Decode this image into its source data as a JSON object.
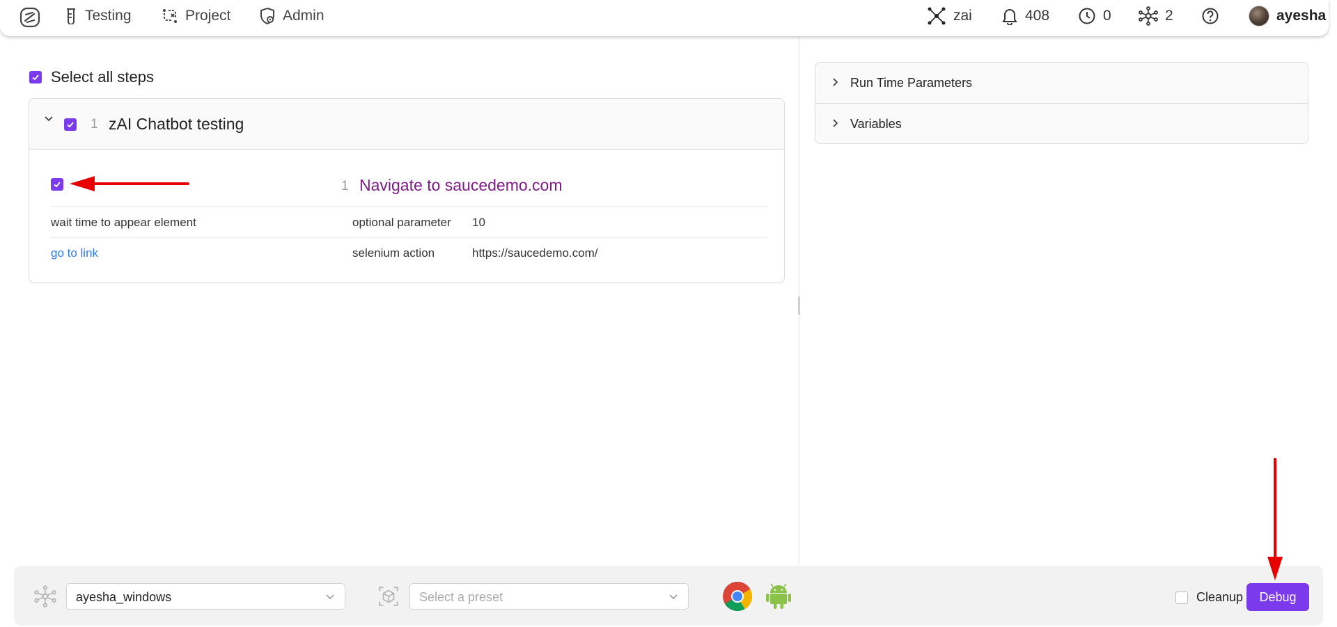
{
  "nav": {
    "items": [
      {
        "label": "Testing",
        "icon": "flask-icon"
      },
      {
        "label": "Project",
        "icon": "workflow-icon"
      },
      {
        "label": "Admin",
        "icon": "shield-gear-icon"
      }
    ],
    "right": {
      "zai_label": "zai",
      "notifications_count": "408",
      "clock_count": "0",
      "network_count": "2",
      "user_name": "ayesha"
    }
  },
  "steps": {
    "select_all_label": "Select all steps",
    "group": {
      "number": "1",
      "title": "zAI Chatbot testing"
    },
    "step": {
      "number": "1",
      "title": "Navigate to saucedemo.com"
    },
    "params": [
      {
        "name": "wait time to appear element",
        "type": "optional parameter",
        "value": "10"
      },
      {
        "name": "go to link",
        "type": "selenium action",
        "value": "https://saucedemo.com/"
      }
    ]
  },
  "right_panel": {
    "accordion": [
      {
        "label": "Run Time Parameters"
      },
      {
        "label": "Variables"
      }
    ]
  },
  "bottom": {
    "machine_value": "ayesha_windows",
    "preset_placeholder": "Select a preset",
    "cleanup_label": "Cleanup",
    "debug_label": "Debug"
  },
  "colors": {
    "accent": "#7c3aed",
    "step_title": "#7e1b87",
    "link": "#2f7ae5",
    "annotation": "#e60000"
  }
}
